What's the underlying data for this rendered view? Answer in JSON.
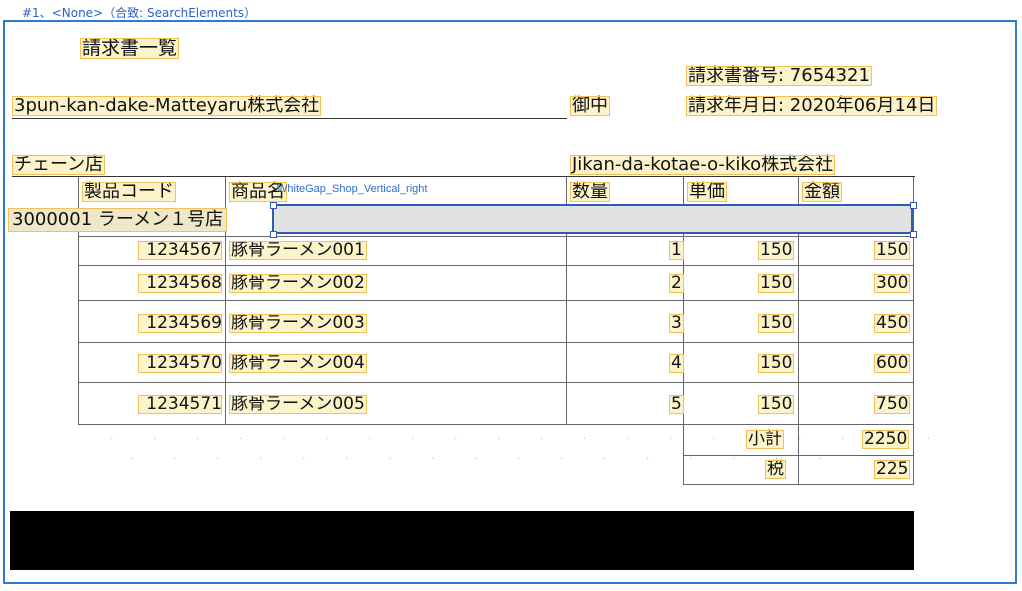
{
  "window": {
    "frame_title": "#1、<None>（合致: SearchElements）",
    "selection_label": "WhiteGap_Shop_Vertical_right"
  },
  "invoice": {
    "title": "請求書一覧",
    "number_label": "請求書番号: 7654321",
    "date_label": "請求年月日: 2020年06月14日",
    "recipient": "3pun-kan-dake-Matteyaru株式会社",
    "honorific": "御中",
    "shop_label": "チェーン店",
    "issuer": "Jikan-da-kotae-o-kiko株式会社",
    "store_row": "3000001 ラーメン１号店"
  },
  "table": {
    "headers": {
      "code": "製品コード",
      "name": "商品名",
      "qty": "数量",
      "unit": "単価",
      "amount": "金額"
    },
    "rows": [
      {
        "code": "1234567",
        "name": "豚骨ラーメン001",
        "qty": "1",
        "unit": "150",
        "amount": "150"
      },
      {
        "code": "1234568",
        "name": "豚骨ラーメン002",
        "qty": "2",
        "unit": "150",
        "amount": "300"
      },
      {
        "code": "1234569",
        "name": "豚骨ラーメン003",
        "qty": "3",
        "unit": "150",
        "amount": "450"
      },
      {
        "code": "1234570",
        "name": "豚骨ラーメン004",
        "qty": "4",
        "unit": "150",
        "amount": "600"
      },
      {
        "code": "1234571",
        "name": "豚骨ラーメン005",
        "qty": "5",
        "unit": "150",
        "amount": "750"
      }
    ],
    "subtotal_label": "小計",
    "subtotal_value": "2250",
    "tax_label": "税",
    "tax_value": "225"
  },
  "colors": {
    "highlight_fill": "#fdf3c9",
    "highlight_border": "#f2c25a",
    "frame_blue": "#2f7ad4",
    "selection_blue": "#2d5db9"
  }
}
